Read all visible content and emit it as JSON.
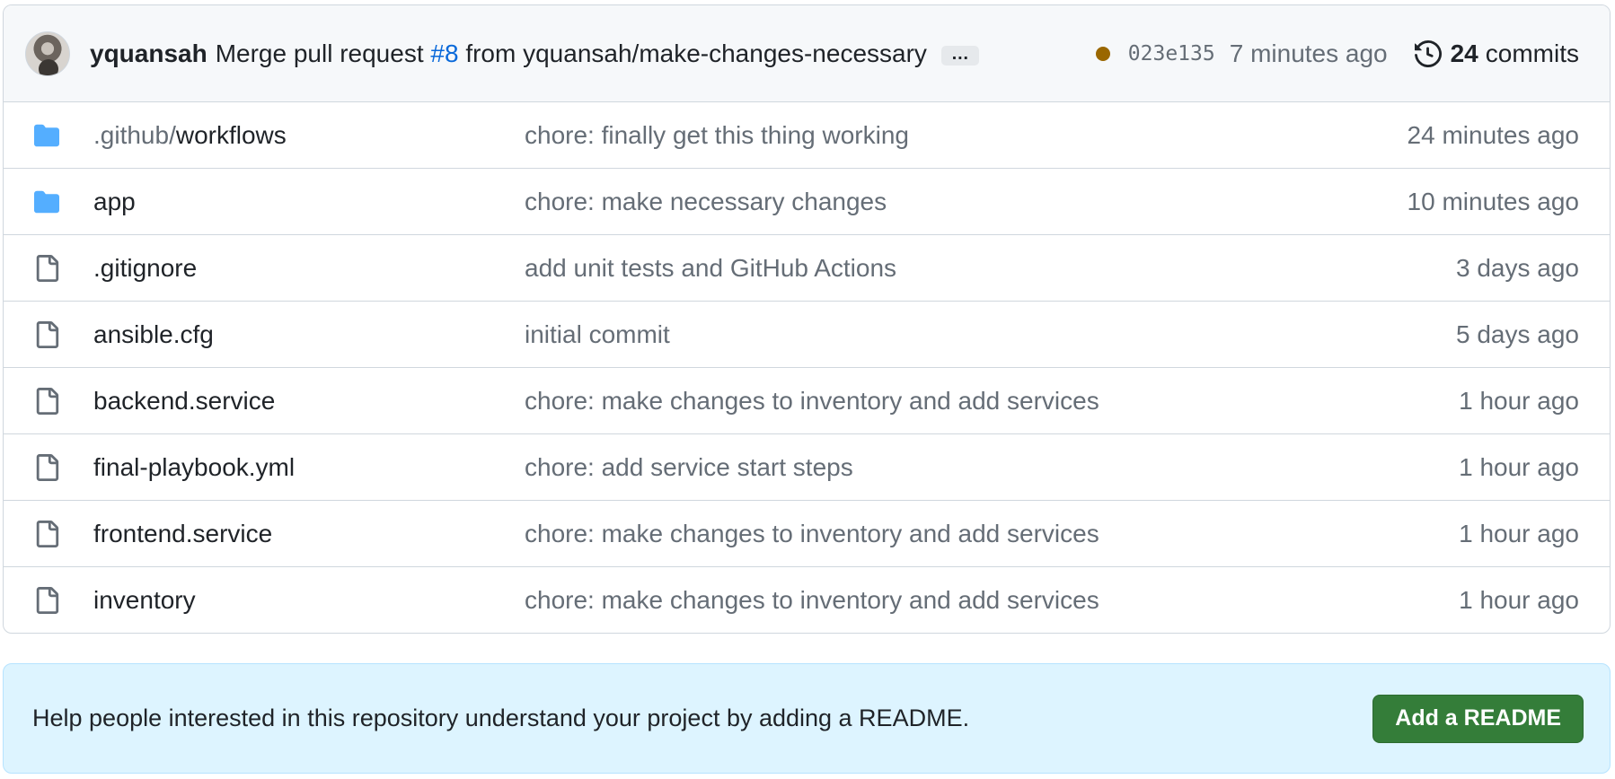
{
  "commit": {
    "author": "yquansah",
    "message_prefix": "Merge pull request ",
    "pr_number": "#8",
    "message_suffix": " from yquansah/make-changes-necessary",
    "ellipsis": "…",
    "status_color": "#9a6700",
    "sha": "023e135",
    "time": "7 minutes ago",
    "commit_count": "24",
    "commits_label": "commits"
  },
  "files": [
    {
      "type": "folder",
      "name_prefix": ".github/",
      "name": "workflows",
      "message": "chore: finally get this thing working",
      "age": "24 minutes ago"
    },
    {
      "type": "folder",
      "name_prefix": "",
      "name": "app",
      "message": "chore: make necessary changes",
      "age": "10 minutes ago"
    },
    {
      "type": "file",
      "name_prefix": "",
      "name": ".gitignore",
      "message": "add unit tests and GitHub Actions",
      "age": "3 days ago"
    },
    {
      "type": "file",
      "name_prefix": "",
      "name": "ansible.cfg",
      "message": "initial commit",
      "age": "5 days ago"
    },
    {
      "type": "file",
      "name_prefix": "",
      "name": "backend.service",
      "message": "chore: make changes to inventory and add services",
      "age": "1 hour ago"
    },
    {
      "type": "file",
      "name_prefix": "",
      "name": "final-playbook.yml",
      "message": "chore: add service start steps",
      "age": "1 hour ago"
    },
    {
      "type": "file",
      "name_prefix": "",
      "name": "frontend.service",
      "message": "chore: make changes to inventory and add services",
      "age": "1 hour ago"
    },
    {
      "type": "file",
      "name_prefix": "",
      "name": "inventory",
      "message": "chore: make changes to inventory and add services",
      "age": "1 hour ago"
    }
  ],
  "readme": {
    "text": "Help people interested in this repository understand your project by adding a README.",
    "button_label": "Add a README"
  },
  "colors": {
    "folder": "#54aeff",
    "file_icon": "#656d76",
    "link": "#0969da",
    "readme_button": "#347d39"
  }
}
